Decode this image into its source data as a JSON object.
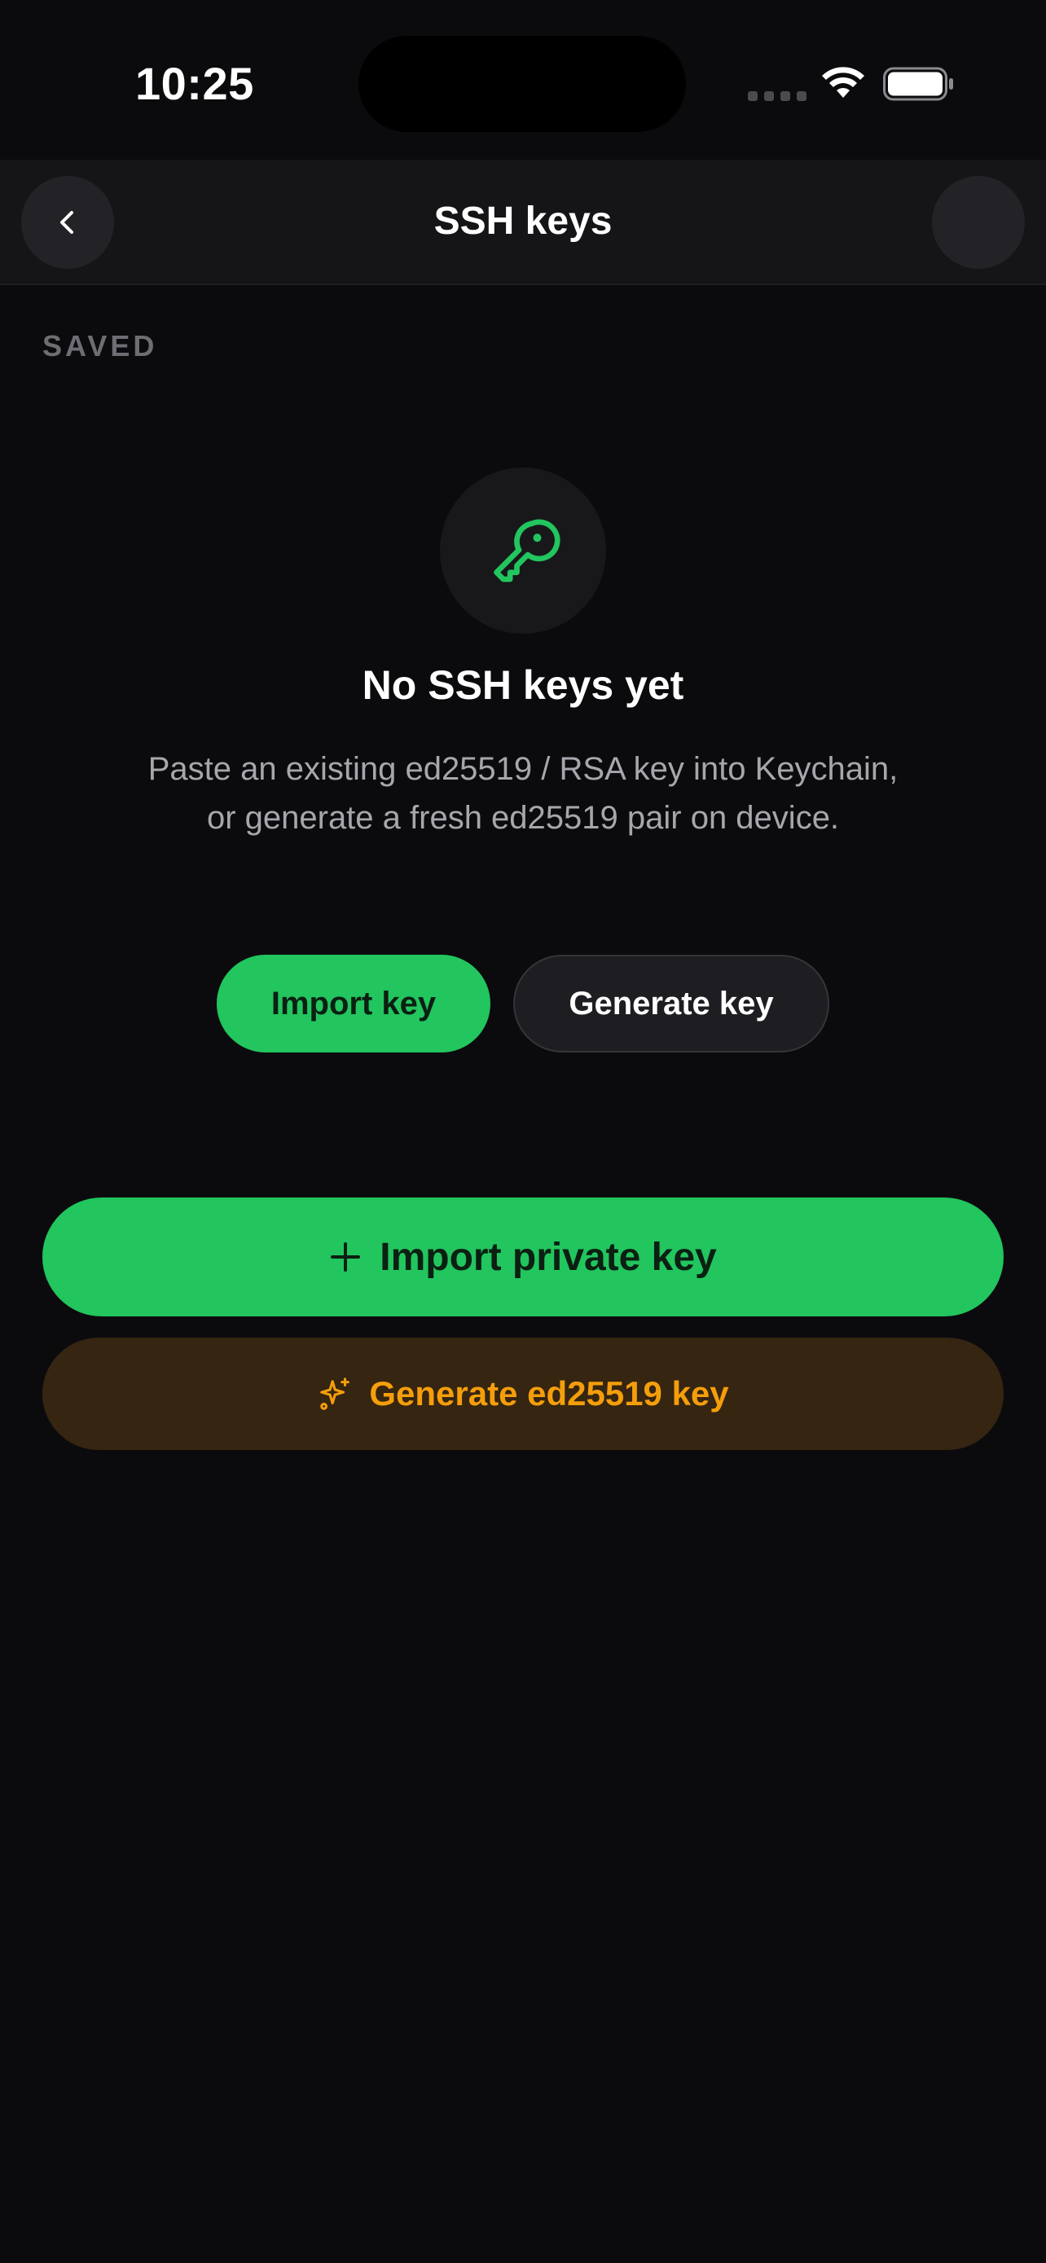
{
  "status_bar": {
    "time": "10:25",
    "wifi_icon": "wifi-icon",
    "battery_icon": "battery-icon"
  },
  "nav": {
    "title": "SSH keys",
    "back_icon": "chevron-left-icon"
  },
  "section": {
    "label": "SAVED"
  },
  "empty_state": {
    "icon": "key-icon",
    "title": "No SSH keys yet",
    "description": "Paste an existing ed25519 / RSA key into Keychain, or generate a fresh ed25519 pair on device.",
    "import_label": "Import key",
    "generate_label": "Generate key"
  },
  "actions": {
    "import_private_label": "Import private key",
    "import_icon": "plus-icon",
    "generate_ed25519_label": "Generate ed25519 key",
    "generate_icon": "sparkles-icon"
  },
  "colors": {
    "background": "#0b0b0d",
    "accent_green": "#22c55e",
    "accent_amber": "#f59e0b",
    "amber_bg": "#352511"
  }
}
